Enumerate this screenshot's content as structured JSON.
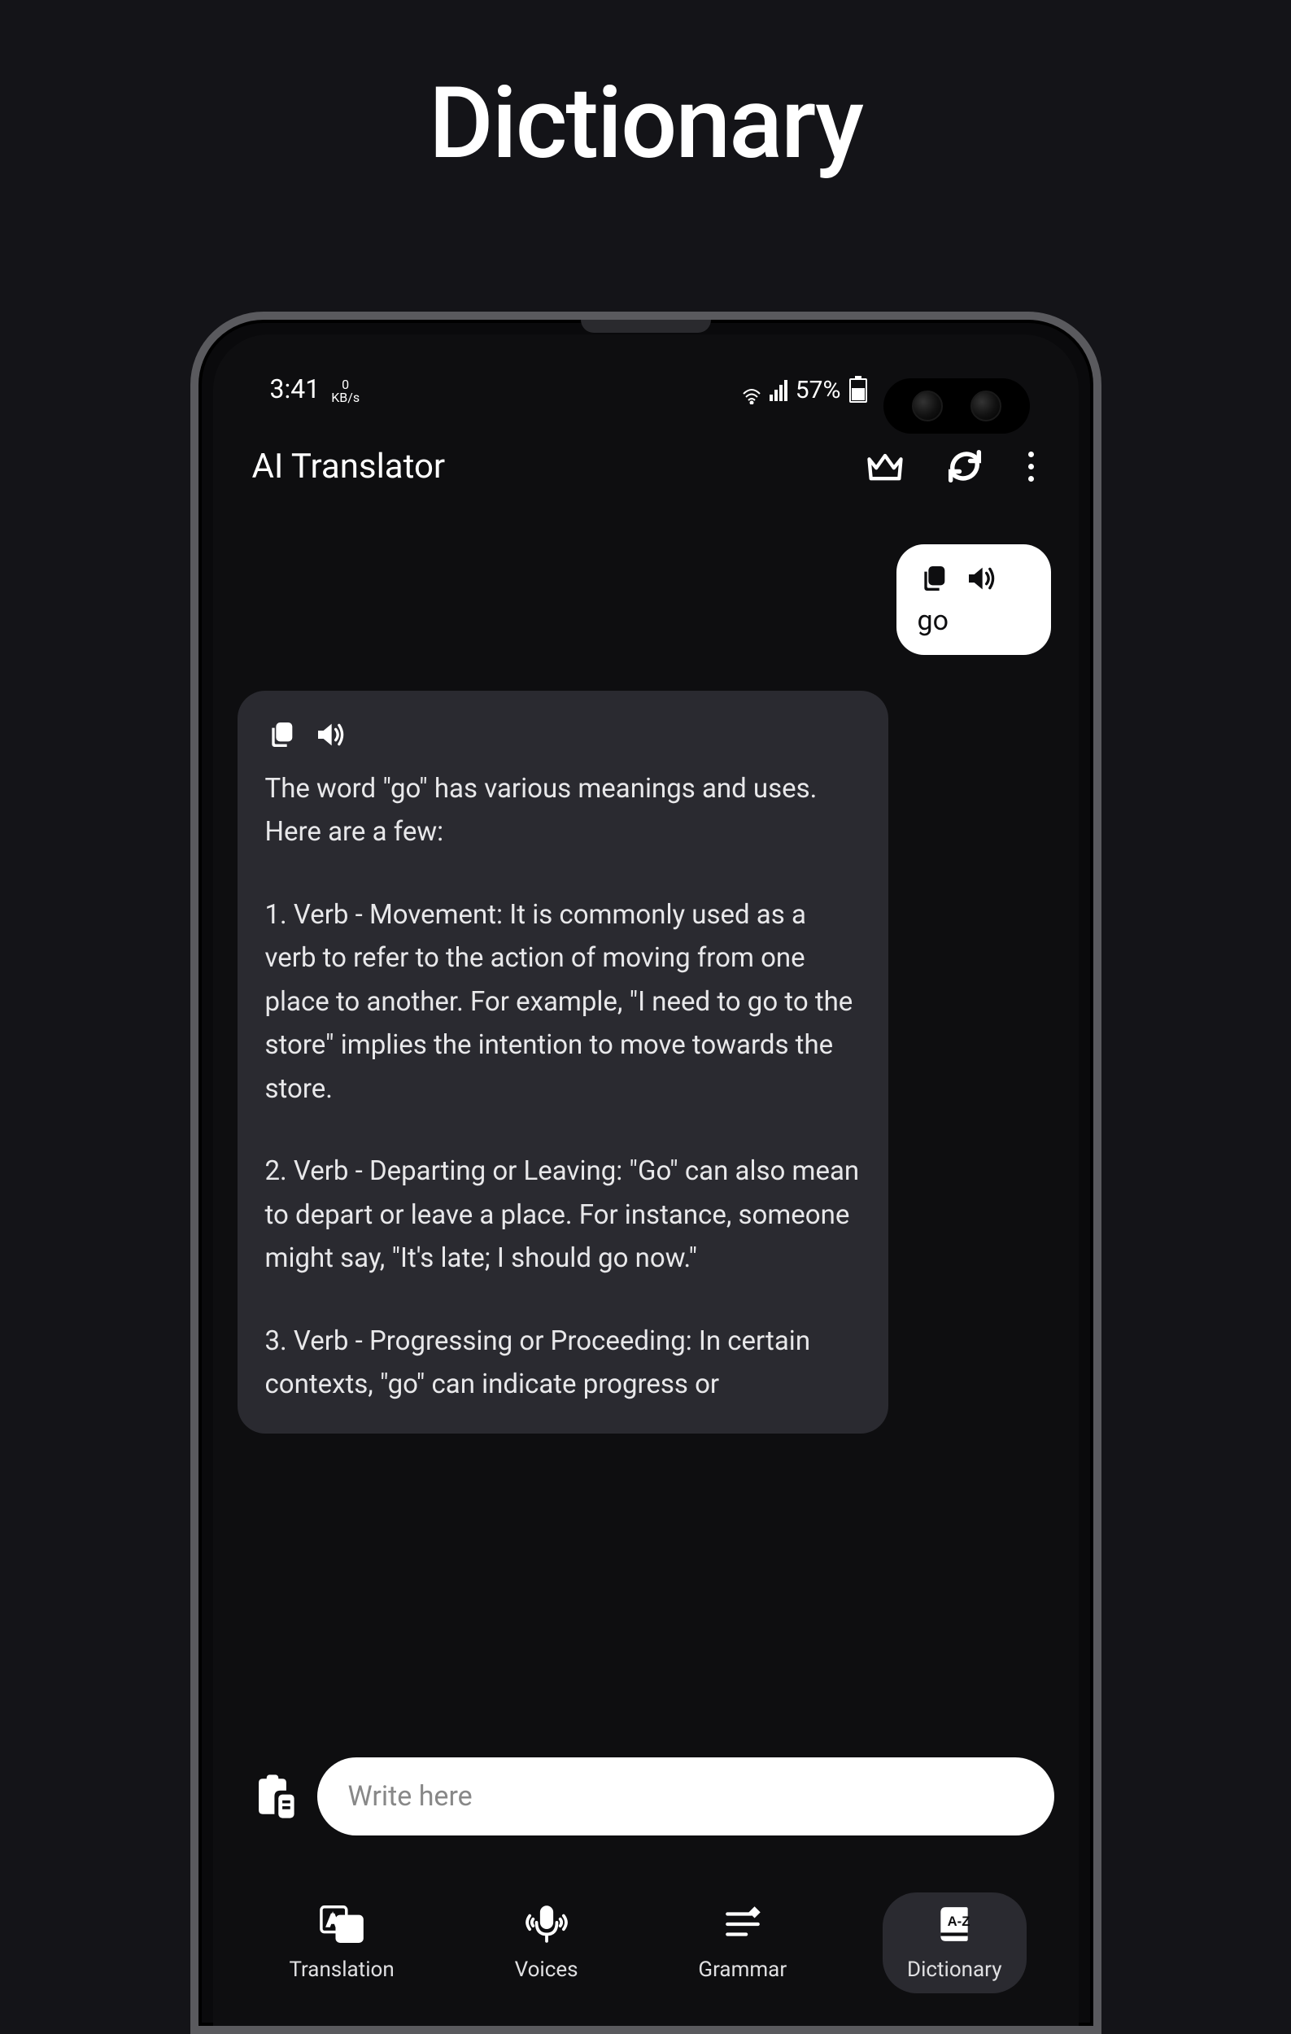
{
  "page": {
    "title": "Dictionary"
  },
  "status_bar": {
    "time": "3:41",
    "kbs_top": "0",
    "kbs_bottom": "KB/s",
    "battery_pct": "57%"
  },
  "header": {
    "title": "AI Translator"
  },
  "chat": {
    "user": {
      "text": "go"
    },
    "ai": {
      "intro": "The word \"go\" has various meanings and uses. Here are a few:",
      "p1": "1. Verb - Movement: It is commonly used as a verb to refer to the action of moving from one place to another. For example, \"I need to go to the store\" implies the intention to move towards the store.",
      "p2": "2. Verb - Departing or Leaving: \"Go\" can also mean to depart or leave a place. For instance, someone might say, \"It's late; I should go now.\"",
      "p3": "3. Verb - Progressing or Proceeding: In certain contexts, \"go\" can indicate progress or"
    }
  },
  "input": {
    "placeholder": "Write here"
  },
  "nav": {
    "items": [
      {
        "label": "Translation"
      },
      {
        "label": "Voices"
      },
      {
        "label": "Grammar"
      },
      {
        "label": "Dictionary"
      }
    ]
  }
}
